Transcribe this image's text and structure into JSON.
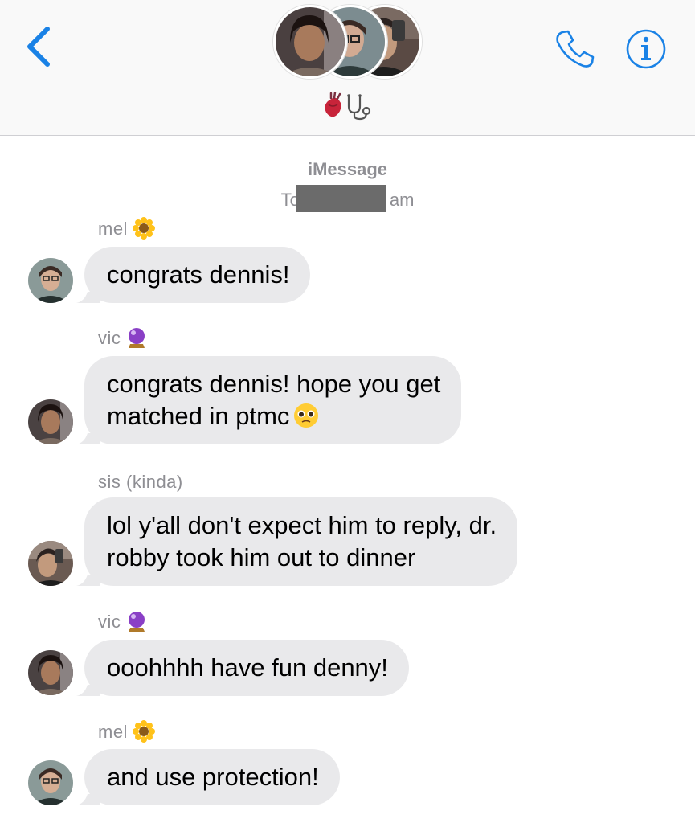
{
  "header": {
    "group_emoji": [
      "anatomical-heart",
      "stethoscope"
    ],
    "back_icon": "chevron-left-icon",
    "call_icon": "phone-icon",
    "info_icon": "info-circle-icon",
    "accent_color": "#1a82e6"
  },
  "thread": {
    "service_label": "iMessage",
    "timestamp_prefix": "To",
    "timestamp_suffix": "am"
  },
  "messages": [
    {
      "sender": "mel",
      "sender_emoji": "sunflower",
      "text": "congrats dennis!"
    },
    {
      "sender": "vic",
      "sender_emoji": "crystal-ball",
      "line1": "congrats dennis! hope you get",
      "line2": "matched in ptmc",
      "trailing_emoji": "pleading-face"
    },
    {
      "sender": "sis (kinda)",
      "line1": "lol y'all don't expect him to reply, dr.",
      "line2": "robby took him out to dinner"
    },
    {
      "sender": "vic",
      "sender_emoji": "crystal-ball",
      "text": "ooohhhh have fun denny!"
    },
    {
      "sender": "mel",
      "sender_emoji": "sunflower",
      "text": "and use protection!"
    }
  ],
  "colors": {
    "bubble_bg": "#e9e9eb",
    "meta_text": "#8e8e93"
  }
}
